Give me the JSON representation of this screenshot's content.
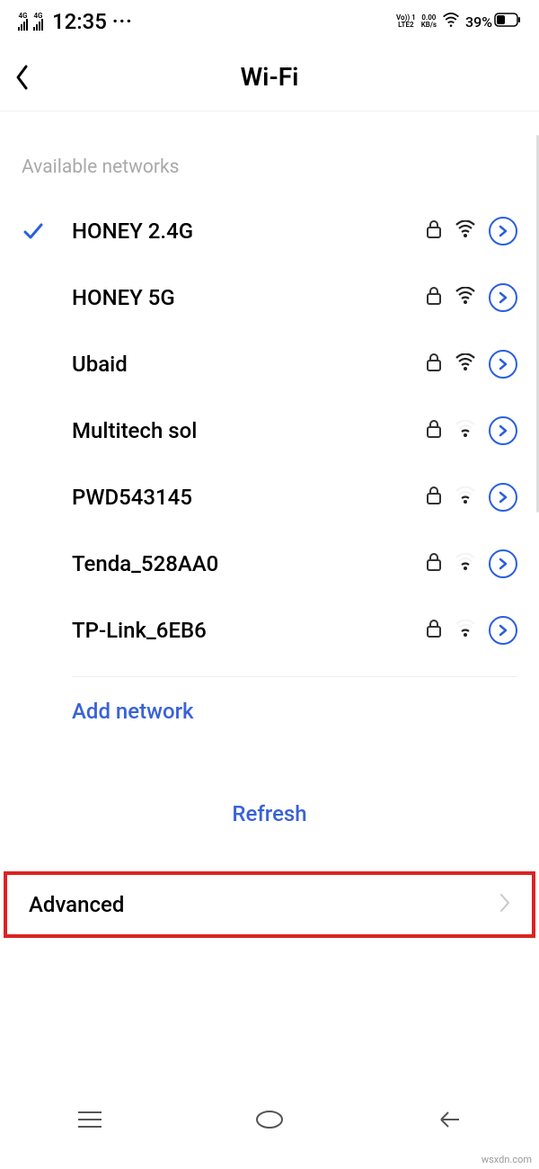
{
  "status": {
    "signal1_label": "4G",
    "signal2_label": "4G",
    "time": "12:35",
    "ellipsis": "···",
    "lte_line1": "Vo)) 1",
    "lte_line2": "LTE2",
    "data_line1": "0.00",
    "data_line2": "KB/s",
    "battery_pct": "39%"
  },
  "header": {
    "title": "Wi-Fi"
  },
  "section_label": "Available networks",
  "networks": [
    {
      "name": "HONEY 2.4G",
      "connected": true,
      "secured": true,
      "strength": "strong"
    },
    {
      "name": "HONEY 5G",
      "connected": false,
      "secured": true,
      "strength": "strong"
    },
    {
      "name": "Ubaid",
      "connected": false,
      "secured": true,
      "strength": "strong"
    },
    {
      "name": "Multitech sol",
      "connected": false,
      "secured": true,
      "strength": "weak"
    },
    {
      "name": "PWD543145",
      "connected": false,
      "secured": true,
      "strength": "weak"
    },
    {
      "name": "Tenda_528AA0",
      "connected": false,
      "secured": true,
      "strength": "weak"
    },
    {
      "name": "TP-Link_6EB6",
      "connected": false,
      "secured": true,
      "strength": "weak"
    }
  ],
  "add_network": "Add network",
  "refresh": "Refresh",
  "advanced": "Advanced",
  "watermark": "wsxdn.com"
}
